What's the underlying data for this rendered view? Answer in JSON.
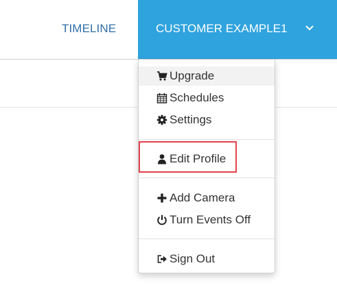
{
  "nav": {
    "timeline_label": "TIMELINE",
    "customer_label": "CUSTOMER EXAMPLE1",
    "customer_bg": "#2fa3de",
    "timeline_color": "#2f6fa7"
  },
  "dropdown": {
    "items": [
      {
        "label": "Upgrade",
        "icon": "cart-icon"
      },
      {
        "label": "Schedules",
        "icon": "calendar-icon"
      },
      {
        "label": "Settings",
        "icon": "gear-icon"
      },
      {
        "label": "Edit Profile",
        "icon": "user-icon"
      },
      {
        "label": "Add Camera",
        "icon": "plus-icon"
      },
      {
        "label": "Turn Events Off",
        "icon": "power-icon"
      },
      {
        "label": "Sign Out",
        "icon": "sign-out-icon"
      }
    ],
    "highlight_color": "#e0424b"
  }
}
